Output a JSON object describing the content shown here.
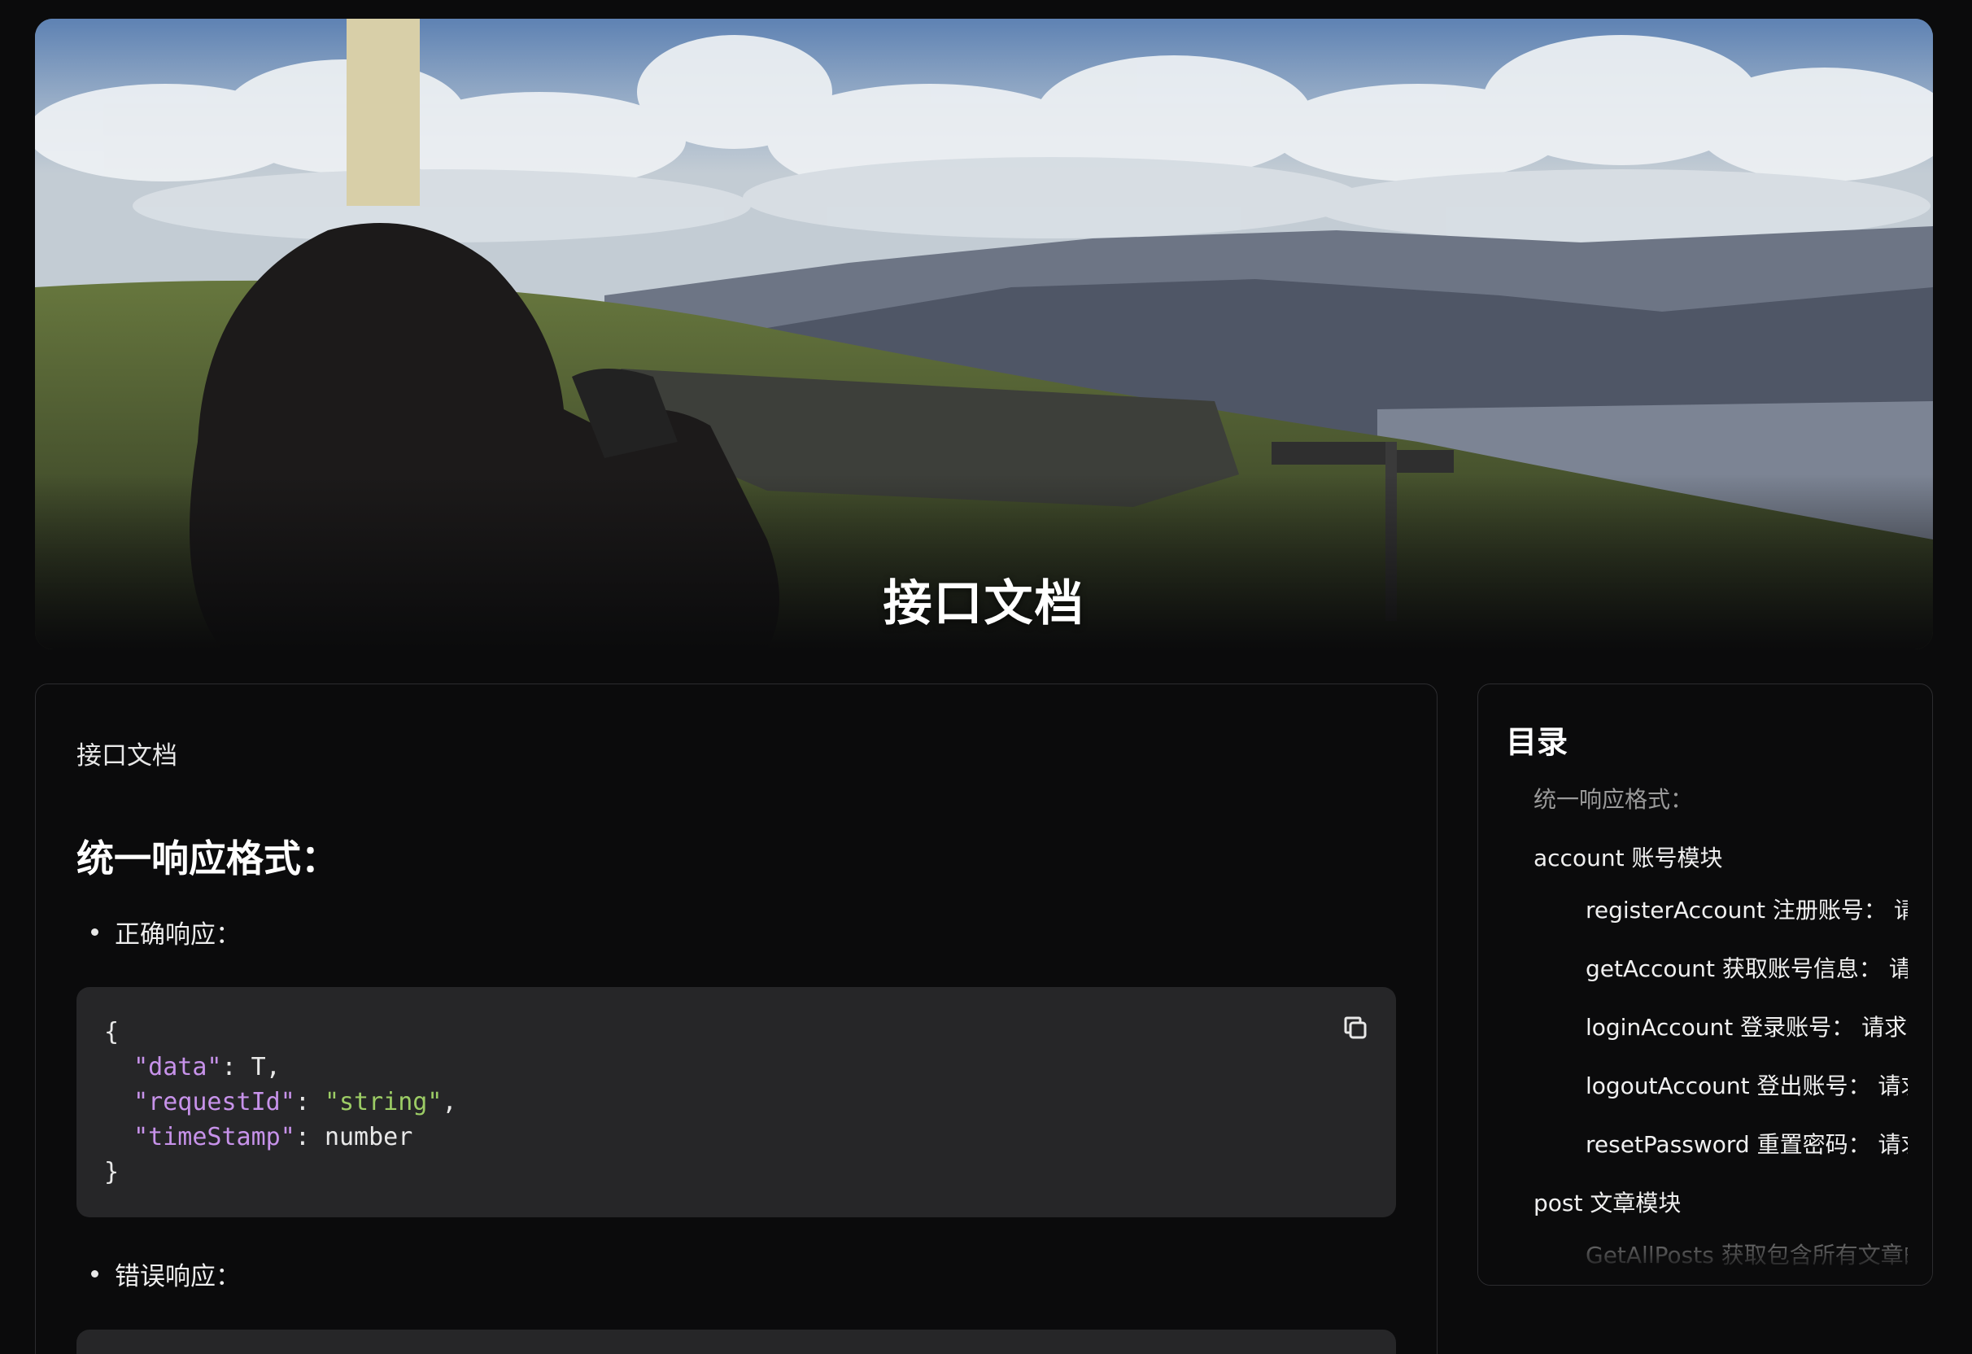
{
  "hero": {
    "title": "接口文档"
  },
  "article": {
    "breadcrumb": "接口文档",
    "section_heading": "统一响应格式：",
    "bullets": [
      "正确响应：",
      "错误响应："
    ],
    "code_block_1": {
      "lines": [
        {
          "text": "{"
        },
        {
          "indent": "  ",
          "key": "\"data\"",
          "sep": ": ",
          "value": "T",
          "value_type": "plain",
          "trail": ","
        },
        {
          "indent": "  ",
          "key": "\"requestId\"",
          "sep": ": ",
          "value": "\"string\"",
          "value_type": "string",
          "trail": ","
        },
        {
          "indent": "  ",
          "key": "\"timeStamp\"",
          "sep": ": ",
          "value": "number",
          "value_type": "plain",
          "trail": ""
        },
        {
          "text": "}"
        }
      ],
      "copy_icon": "copy-icon"
    }
  },
  "toc": {
    "title": "目录",
    "items": [
      {
        "label": "统一响应格式：",
        "level": 1,
        "muted": true
      },
      {
        "label": "account 账号模块",
        "level": 1
      },
      {
        "label": "registerAccount 注册账号： 请求方式",
        "level": 2
      },
      {
        "label": "getAccount 获取账号信息： 请求方式",
        "level": 2
      },
      {
        "label": "loginAccount 登录账号： 请求方式",
        "level": 2
      },
      {
        "label": "logoutAccount 登出账号： 请求方式",
        "level": 2
      },
      {
        "label": "resetPassword 重置密码： 请求方式",
        "level": 2
      },
      {
        "label": "post 文章模块",
        "level": 1
      },
      {
        "label": "GetAllPosts 获取包含所有文章的列表",
        "level": 2,
        "muted": true
      }
    ]
  },
  "colors": {
    "background": "#0b0b0c",
    "code_bg": "#262628",
    "json_key": "#c792ea",
    "json_string": "#9ccc65",
    "border": "#2c2c2f"
  }
}
